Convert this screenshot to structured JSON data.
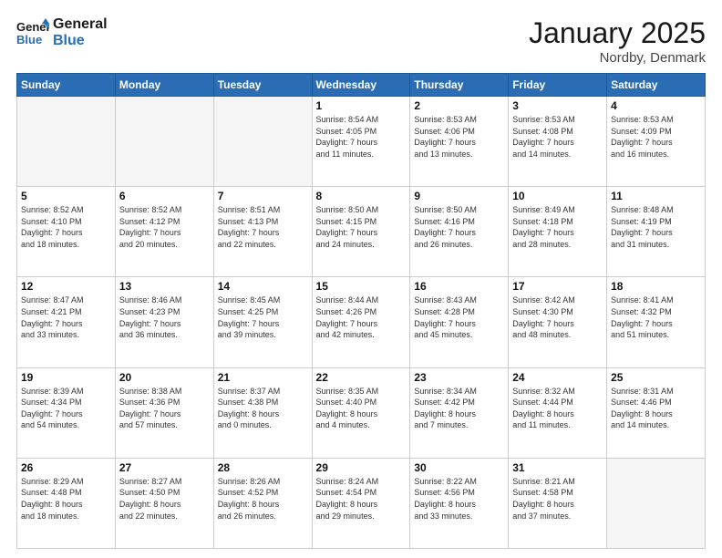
{
  "logo": {
    "line1": "General",
    "line2": "Blue"
  },
  "title": "January 2025",
  "location": "Nordby, Denmark",
  "days_of_week": [
    "Sunday",
    "Monday",
    "Tuesday",
    "Wednesday",
    "Thursday",
    "Friday",
    "Saturday"
  ],
  "weeks": [
    [
      {
        "day": "",
        "info": ""
      },
      {
        "day": "",
        "info": ""
      },
      {
        "day": "",
        "info": ""
      },
      {
        "day": "1",
        "info": "Sunrise: 8:54 AM\nSunset: 4:05 PM\nDaylight: 7 hours\nand 11 minutes."
      },
      {
        "day": "2",
        "info": "Sunrise: 8:53 AM\nSunset: 4:06 PM\nDaylight: 7 hours\nand 13 minutes."
      },
      {
        "day": "3",
        "info": "Sunrise: 8:53 AM\nSunset: 4:08 PM\nDaylight: 7 hours\nand 14 minutes."
      },
      {
        "day": "4",
        "info": "Sunrise: 8:53 AM\nSunset: 4:09 PM\nDaylight: 7 hours\nand 16 minutes."
      }
    ],
    [
      {
        "day": "5",
        "info": "Sunrise: 8:52 AM\nSunset: 4:10 PM\nDaylight: 7 hours\nand 18 minutes."
      },
      {
        "day": "6",
        "info": "Sunrise: 8:52 AM\nSunset: 4:12 PM\nDaylight: 7 hours\nand 20 minutes."
      },
      {
        "day": "7",
        "info": "Sunrise: 8:51 AM\nSunset: 4:13 PM\nDaylight: 7 hours\nand 22 minutes."
      },
      {
        "day": "8",
        "info": "Sunrise: 8:50 AM\nSunset: 4:15 PM\nDaylight: 7 hours\nand 24 minutes."
      },
      {
        "day": "9",
        "info": "Sunrise: 8:50 AM\nSunset: 4:16 PM\nDaylight: 7 hours\nand 26 minutes."
      },
      {
        "day": "10",
        "info": "Sunrise: 8:49 AM\nSunset: 4:18 PM\nDaylight: 7 hours\nand 28 minutes."
      },
      {
        "day": "11",
        "info": "Sunrise: 8:48 AM\nSunset: 4:19 PM\nDaylight: 7 hours\nand 31 minutes."
      }
    ],
    [
      {
        "day": "12",
        "info": "Sunrise: 8:47 AM\nSunset: 4:21 PM\nDaylight: 7 hours\nand 33 minutes."
      },
      {
        "day": "13",
        "info": "Sunrise: 8:46 AM\nSunset: 4:23 PM\nDaylight: 7 hours\nand 36 minutes."
      },
      {
        "day": "14",
        "info": "Sunrise: 8:45 AM\nSunset: 4:25 PM\nDaylight: 7 hours\nand 39 minutes."
      },
      {
        "day": "15",
        "info": "Sunrise: 8:44 AM\nSunset: 4:26 PM\nDaylight: 7 hours\nand 42 minutes."
      },
      {
        "day": "16",
        "info": "Sunrise: 8:43 AM\nSunset: 4:28 PM\nDaylight: 7 hours\nand 45 minutes."
      },
      {
        "day": "17",
        "info": "Sunrise: 8:42 AM\nSunset: 4:30 PM\nDaylight: 7 hours\nand 48 minutes."
      },
      {
        "day": "18",
        "info": "Sunrise: 8:41 AM\nSunset: 4:32 PM\nDaylight: 7 hours\nand 51 minutes."
      }
    ],
    [
      {
        "day": "19",
        "info": "Sunrise: 8:39 AM\nSunset: 4:34 PM\nDaylight: 7 hours\nand 54 minutes."
      },
      {
        "day": "20",
        "info": "Sunrise: 8:38 AM\nSunset: 4:36 PM\nDaylight: 7 hours\nand 57 minutes."
      },
      {
        "day": "21",
        "info": "Sunrise: 8:37 AM\nSunset: 4:38 PM\nDaylight: 8 hours\nand 0 minutes."
      },
      {
        "day": "22",
        "info": "Sunrise: 8:35 AM\nSunset: 4:40 PM\nDaylight: 8 hours\nand 4 minutes."
      },
      {
        "day": "23",
        "info": "Sunrise: 8:34 AM\nSunset: 4:42 PM\nDaylight: 8 hours\nand 7 minutes."
      },
      {
        "day": "24",
        "info": "Sunrise: 8:32 AM\nSunset: 4:44 PM\nDaylight: 8 hours\nand 11 minutes."
      },
      {
        "day": "25",
        "info": "Sunrise: 8:31 AM\nSunset: 4:46 PM\nDaylight: 8 hours\nand 14 minutes."
      }
    ],
    [
      {
        "day": "26",
        "info": "Sunrise: 8:29 AM\nSunset: 4:48 PM\nDaylight: 8 hours\nand 18 minutes."
      },
      {
        "day": "27",
        "info": "Sunrise: 8:27 AM\nSunset: 4:50 PM\nDaylight: 8 hours\nand 22 minutes."
      },
      {
        "day": "28",
        "info": "Sunrise: 8:26 AM\nSunset: 4:52 PM\nDaylight: 8 hours\nand 26 minutes."
      },
      {
        "day": "29",
        "info": "Sunrise: 8:24 AM\nSunset: 4:54 PM\nDaylight: 8 hours\nand 29 minutes."
      },
      {
        "day": "30",
        "info": "Sunrise: 8:22 AM\nSunset: 4:56 PM\nDaylight: 8 hours\nand 33 minutes."
      },
      {
        "day": "31",
        "info": "Sunrise: 8:21 AM\nSunset: 4:58 PM\nDaylight: 8 hours\nand 37 minutes."
      },
      {
        "day": "",
        "info": ""
      }
    ]
  ]
}
